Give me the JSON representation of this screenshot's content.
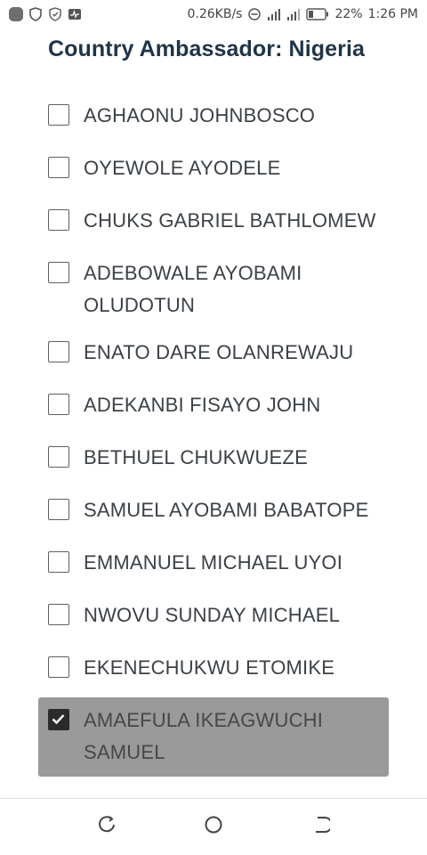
{
  "status_bar": {
    "net_speed": "0.26KB/s",
    "battery_percent": "22%",
    "time": "1:26 PM",
    "icons": [
      "app-dot-icon",
      "shield-icon",
      "shield-check-icon",
      "activity-icon",
      "do-not-disturb-icon",
      "signal-icon",
      "signal-icon",
      "battery-icon"
    ]
  },
  "page": {
    "title": "Country Ambassador: Nigeria"
  },
  "options": [
    {
      "label": "AGHAONU JOHNBOSCO",
      "checked": false
    },
    {
      "label": "OYEWOLE AYODELE",
      "checked": false
    },
    {
      "label": "CHUKS GABRIEL BATHLOMEW",
      "checked": false
    },
    {
      "label": "ADEBOWALE AYOBAMI OLUDOTUN",
      "checked": false
    },
    {
      "label": "ENATO DARE OLANREWAJU",
      "checked": false
    },
    {
      "label": "ADEKANBI FISAYO JOHN",
      "checked": false
    },
    {
      "label": "BETHUEL CHUKWUEZE",
      "checked": false
    },
    {
      "label": "SAMUEL AYOBAMI BABATOPE",
      "checked": false
    },
    {
      "label": "EMMANUEL MICHAEL UYOI",
      "checked": false
    },
    {
      "label": "NWOVU SUNDAY MICHAEL",
      "checked": false
    },
    {
      "label": "EKENECHUKWU ETOMIKE",
      "checked": false
    },
    {
      "label": "AMAEFULA IKEAGWUCHI SAMUEL",
      "checked": true
    }
  ],
  "colors": {
    "title": "#1f3447",
    "selected_bg": "#9a9a9a",
    "checkbox_checked": "#2b2b2b"
  },
  "nav_bar": {
    "icons": [
      "recent-apps-icon",
      "home-icon",
      "back-icon"
    ]
  }
}
